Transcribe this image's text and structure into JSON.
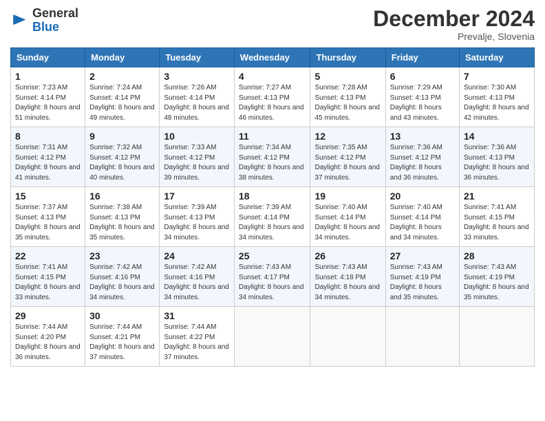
{
  "header": {
    "logo": {
      "text_general": "General",
      "text_blue": "Blue"
    },
    "title": "December 2024",
    "subtitle": "Prevalje, Slovenia"
  },
  "days_of_week": [
    "Sunday",
    "Monday",
    "Tuesday",
    "Wednesday",
    "Thursday",
    "Friday",
    "Saturday"
  ],
  "weeks": [
    [
      {
        "day": 1,
        "sunrise": "7:23 AM",
        "sunset": "4:14 PM",
        "daylight": "8 hours and 51 minutes."
      },
      {
        "day": 2,
        "sunrise": "7:24 AM",
        "sunset": "4:14 PM",
        "daylight": "8 hours and 49 minutes."
      },
      {
        "day": 3,
        "sunrise": "7:26 AM",
        "sunset": "4:14 PM",
        "daylight": "8 hours and 48 minutes."
      },
      {
        "day": 4,
        "sunrise": "7:27 AM",
        "sunset": "4:13 PM",
        "daylight": "8 hours and 46 minutes."
      },
      {
        "day": 5,
        "sunrise": "7:28 AM",
        "sunset": "4:13 PM",
        "daylight": "8 hours and 45 minutes."
      },
      {
        "day": 6,
        "sunrise": "7:29 AM",
        "sunset": "4:13 PM",
        "daylight": "8 hours and 43 minutes."
      },
      {
        "day": 7,
        "sunrise": "7:30 AM",
        "sunset": "4:13 PM",
        "daylight": "8 hours and 42 minutes."
      }
    ],
    [
      {
        "day": 8,
        "sunrise": "7:31 AM",
        "sunset": "4:12 PM",
        "daylight": "8 hours and 41 minutes."
      },
      {
        "day": 9,
        "sunrise": "7:32 AM",
        "sunset": "4:12 PM",
        "daylight": "8 hours and 40 minutes."
      },
      {
        "day": 10,
        "sunrise": "7:33 AM",
        "sunset": "4:12 PM",
        "daylight": "8 hours and 39 minutes."
      },
      {
        "day": 11,
        "sunrise": "7:34 AM",
        "sunset": "4:12 PM",
        "daylight": "8 hours and 38 minutes."
      },
      {
        "day": 12,
        "sunrise": "7:35 AM",
        "sunset": "4:12 PM",
        "daylight": "8 hours and 37 minutes."
      },
      {
        "day": 13,
        "sunrise": "7:36 AM",
        "sunset": "4:12 PM",
        "daylight": "8 hours and 36 minutes."
      },
      {
        "day": 14,
        "sunrise": "7:36 AM",
        "sunset": "4:13 PM",
        "daylight": "8 hours and 36 minutes."
      }
    ],
    [
      {
        "day": 15,
        "sunrise": "7:37 AM",
        "sunset": "4:13 PM",
        "daylight": "8 hours and 35 minutes."
      },
      {
        "day": 16,
        "sunrise": "7:38 AM",
        "sunset": "4:13 PM",
        "daylight": "8 hours and 35 minutes."
      },
      {
        "day": 17,
        "sunrise": "7:39 AM",
        "sunset": "4:13 PM",
        "daylight": "8 hours and 34 minutes."
      },
      {
        "day": 18,
        "sunrise": "7:39 AM",
        "sunset": "4:14 PM",
        "daylight": "8 hours and 34 minutes."
      },
      {
        "day": 19,
        "sunrise": "7:40 AM",
        "sunset": "4:14 PM",
        "daylight": "8 hours and 34 minutes."
      },
      {
        "day": 20,
        "sunrise": "7:40 AM",
        "sunset": "4:14 PM",
        "daylight": "8 hours and 34 minutes."
      },
      {
        "day": 21,
        "sunrise": "7:41 AM",
        "sunset": "4:15 PM",
        "daylight": "8 hours and 33 minutes."
      }
    ],
    [
      {
        "day": 22,
        "sunrise": "7:41 AM",
        "sunset": "4:15 PM",
        "daylight": "8 hours and 33 minutes."
      },
      {
        "day": 23,
        "sunrise": "7:42 AM",
        "sunset": "4:16 PM",
        "daylight": "8 hours and 34 minutes."
      },
      {
        "day": 24,
        "sunrise": "7:42 AM",
        "sunset": "4:16 PM",
        "daylight": "8 hours and 34 minutes."
      },
      {
        "day": 25,
        "sunrise": "7:43 AM",
        "sunset": "4:17 PM",
        "daylight": "8 hours and 34 minutes."
      },
      {
        "day": 26,
        "sunrise": "7:43 AM",
        "sunset": "4:18 PM",
        "daylight": "8 hours and 34 minutes."
      },
      {
        "day": 27,
        "sunrise": "7:43 AM",
        "sunset": "4:19 PM",
        "daylight": "8 hours and 35 minutes."
      },
      {
        "day": 28,
        "sunrise": "7:43 AM",
        "sunset": "4:19 PM",
        "daylight": "8 hours and 35 minutes."
      }
    ],
    [
      {
        "day": 29,
        "sunrise": "7:44 AM",
        "sunset": "4:20 PM",
        "daylight": "8 hours and 36 minutes."
      },
      {
        "day": 30,
        "sunrise": "7:44 AM",
        "sunset": "4:21 PM",
        "daylight": "8 hours and 37 minutes."
      },
      {
        "day": 31,
        "sunrise": "7:44 AM",
        "sunset": "4:22 PM",
        "daylight": "8 hours and 37 minutes."
      },
      null,
      null,
      null,
      null
    ]
  ]
}
